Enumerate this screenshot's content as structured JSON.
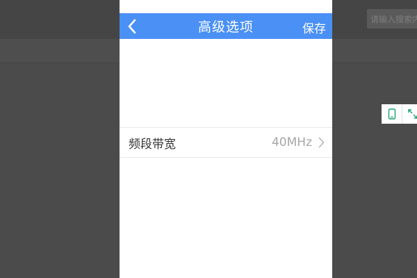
{
  "background": {
    "search_placeholder": "请输入搜索内容"
  },
  "navbar": {
    "back_icon": "chevron-left-icon",
    "title": "高级选项",
    "save_label": "保存",
    "color": "#4a90f5"
  },
  "settings": {
    "rows": [
      {
        "label": "频段带宽",
        "value": "40MHz",
        "icon": "chevron-right-icon"
      }
    ]
  },
  "tools": {
    "icons": [
      "phone-icon",
      "expand-icon"
    ],
    "accent": "#1aa06d"
  }
}
